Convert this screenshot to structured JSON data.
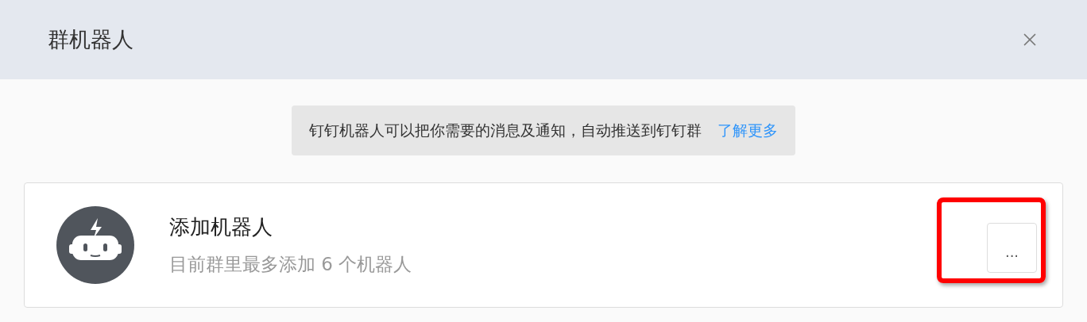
{
  "dialog": {
    "title": "群机器人"
  },
  "notice": {
    "text": "钉钉机器人可以把你需要的消息及通知，自动推送到钉钉群",
    "link": "了解更多"
  },
  "robot_card": {
    "title": "添加机器人",
    "subtitle": "目前群里最多添加 6 个机器人",
    "more_button": "...",
    "highlighted": true
  }
}
